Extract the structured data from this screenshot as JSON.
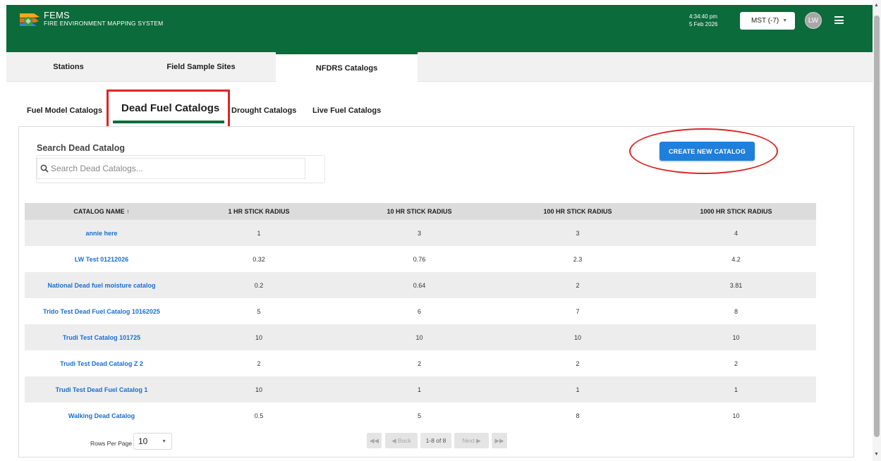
{
  "app": {
    "title": "FEMS",
    "subtitle": "FIRE ENVIRONMENT MAPPING SYSTEM",
    "brand_color": "#0b6b3a"
  },
  "header": {
    "time": "4:34:40 pm",
    "date": "5 Feb 2026",
    "timezone": "MST (-7)",
    "avatar_initials": "LW",
    "menu_icon": "hamburger-icon"
  },
  "top_tabs": [
    {
      "label": "Stations"
    },
    {
      "label": "Field Sample Sites"
    },
    {
      "label": "NFDRS Catalogs",
      "active": true
    }
  ],
  "sub_tabs": [
    {
      "label": "Fuel Model Catalogs"
    },
    {
      "label": "Dead Fuel Catalogs",
      "active": true
    },
    {
      "label": "Drought Catalogs"
    },
    {
      "label": "Live Fuel Catalogs"
    }
  ],
  "search": {
    "label": "Search Dead Catalog",
    "placeholder": "Search Dead Catalogs..."
  },
  "create_button": "CREATE NEW CATALOG",
  "table": {
    "headers": [
      "CATALOG NAME",
      "1 HR STICK RADIUS",
      "10 HR STICK RADIUS",
      "100 HR STICK RADIUS",
      "1000 HR STICK RADIUS"
    ],
    "sort_indicator": "↑",
    "rows": [
      [
        "annie here",
        "1",
        "3",
        "3",
        "4"
      ],
      [
        "LW Test 01212026",
        "0.32",
        "0.76",
        "2.3",
        "4.2"
      ],
      [
        "National Dead fuel moisture catalog",
        "0.2",
        "0.64",
        "2",
        "3.81"
      ],
      [
        "Trido Test Dead Fuel Catalog 10162025",
        "5",
        "6",
        "7",
        "8"
      ],
      [
        "Trudi Test Catalog 101725",
        "10",
        "10",
        "10",
        "10"
      ],
      [
        "Trudi Test Dead Catalog Z 2",
        "2",
        "2",
        "2",
        "2"
      ],
      [
        "Trudi Test Dead Fuel Catalog 1",
        "10",
        "1",
        "1",
        "1"
      ],
      [
        "Walking Dead Catalog",
        "0.5",
        "5",
        "8",
        "10"
      ]
    ]
  },
  "pagination": {
    "rows_per_page_label": "Rows Per Page",
    "rows_per_page": "10",
    "first": "◀◀",
    "back": "◀ Back",
    "info": "1-8 of 8",
    "next": "Next ▶",
    "last": "▶▶"
  },
  "colors": {
    "link": "#1a6fd1",
    "button": "#1f7fdc",
    "annotation": "#e02424"
  }
}
